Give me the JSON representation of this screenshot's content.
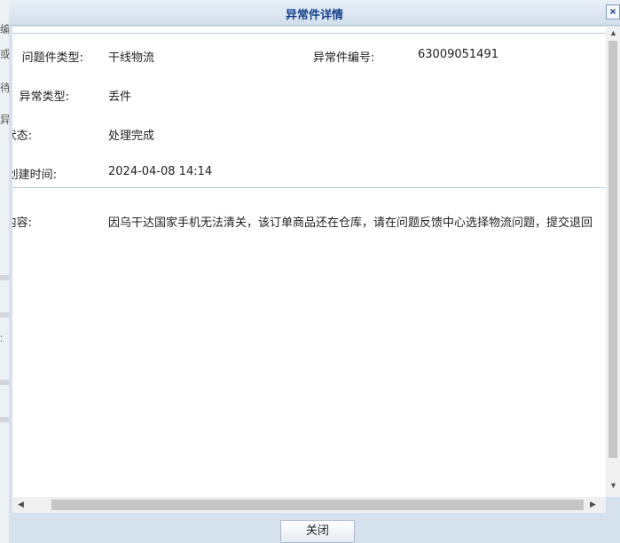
{
  "dialog": {
    "title": "异常件详情",
    "close_symbol": "×",
    "close_button_label": "关闭"
  },
  "fields": {
    "issue_type_label": "问题件类型:",
    "issue_type_value": "干线物流",
    "exception_no_label": "异常件编号:",
    "exception_no_value": "63009051491",
    "exception_type_label": "异常类型:",
    "exception_type_value": "丢件",
    "status_label": "状态:",
    "status_value": "处理完成",
    "created_label": "创建时间:",
    "created_value": "2024-04-08 14:14",
    "content_label": "内容:",
    "content_value": "因乌干达国家手机无法清关，该订单商品还在仓库，请在问题反馈中心选择物流问题，提交退回"
  },
  "background_fragments": [
    "编",
    "或",
    "待",
    "异",
    ":"
  ],
  "icons": {
    "scroll_up": "arrow-up-icon",
    "scroll_down": "arrow-down-icon",
    "scroll_left": "arrow-left-icon",
    "scroll_right": "arrow-right-icon"
  }
}
